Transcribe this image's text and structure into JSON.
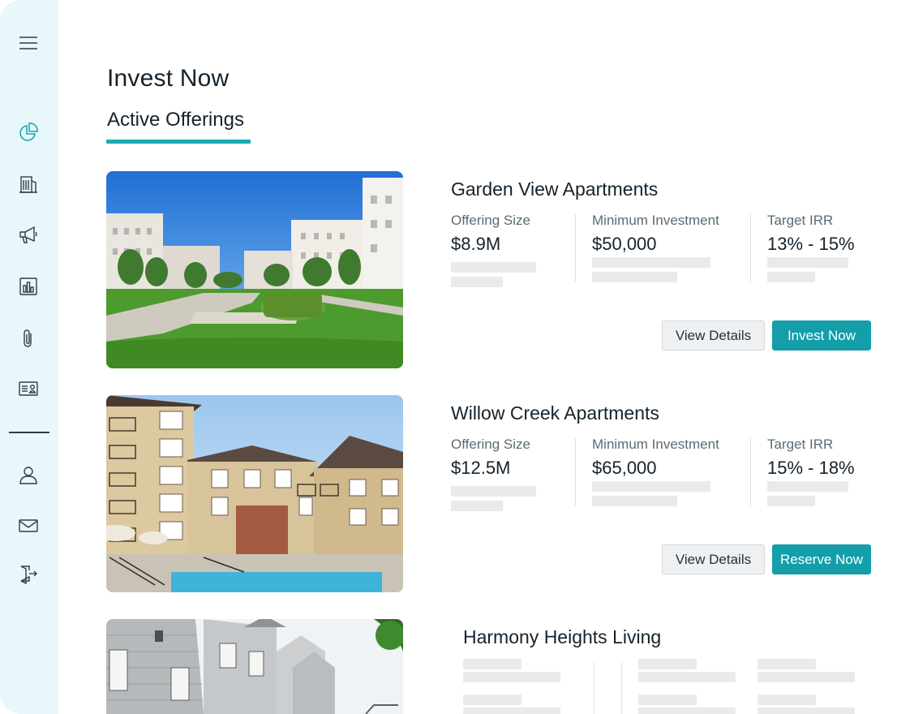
{
  "page": {
    "title": "Invest Now"
  },
  "tabs": {
    "active_label": "Active Offerings"
  },
  "sidebar": {
    "icons": [
      "menu-icon",
      "pie-chart-icon",
      "building-icon",
      "megaphone-icon",
      "bar-chart-icon",
      "paperclip-icon",
      "id-card-icon",
      "user-icon",
      "mail-icon",
      "logout-icon"
    ]
  },
  "offerings": [
    {
      "name": "Garden View Apartments",
      "offering_size_label": "Offering Size",
      "offering_size": "$8.9M",
      "min_investment_label": "Minimum Investment",
      "min_investment": "$50,000",
      "target_irr_label": "Target IRR",
      "target_irr": "13% - 15%",
      "secondary_button": "View Details",
      "primary_button": "Invest Now"
    },
    {
      "name": "Willow Creek Apartments",
      "offering_size_label": "Offering Size",
      "offering_size": "$12.5M",
      "min_investment_label": "Minimum Investment",
      "min_investment": "$65,000",
      "target_irr_label": "Target IRR",
      "target_irr": "15% - 18%",
      "secondary_button": "View Details",
      "primary_button": "Reserve Now"
    },
    {
      "name": "Harmony Heights Living"
    }
  ],
  "colors": {
    "accent": "#139ea9",
    "sidebar_bg": "#e8f7fa",
    "skeleton": "#e8eaec"
  }
}
